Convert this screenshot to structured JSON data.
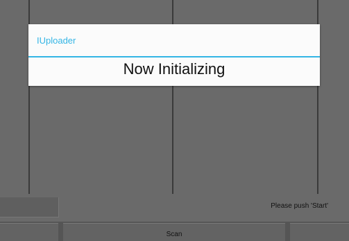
{
  "dialog": {
    "title": "IUploader",
    "message": "Now Initializing"
  },
  "status": {
    "text": "Please push 'Start'"
  },
  "buttons": {
    "left_label": "",
    "scan_label": "Scan",
    "right_label": ""
  },
  "colors": {
    "accent": "#33b5e5",
    "background": "#6a6a6a",
    "dialog_background": "#fbfbfb"
  }
}
